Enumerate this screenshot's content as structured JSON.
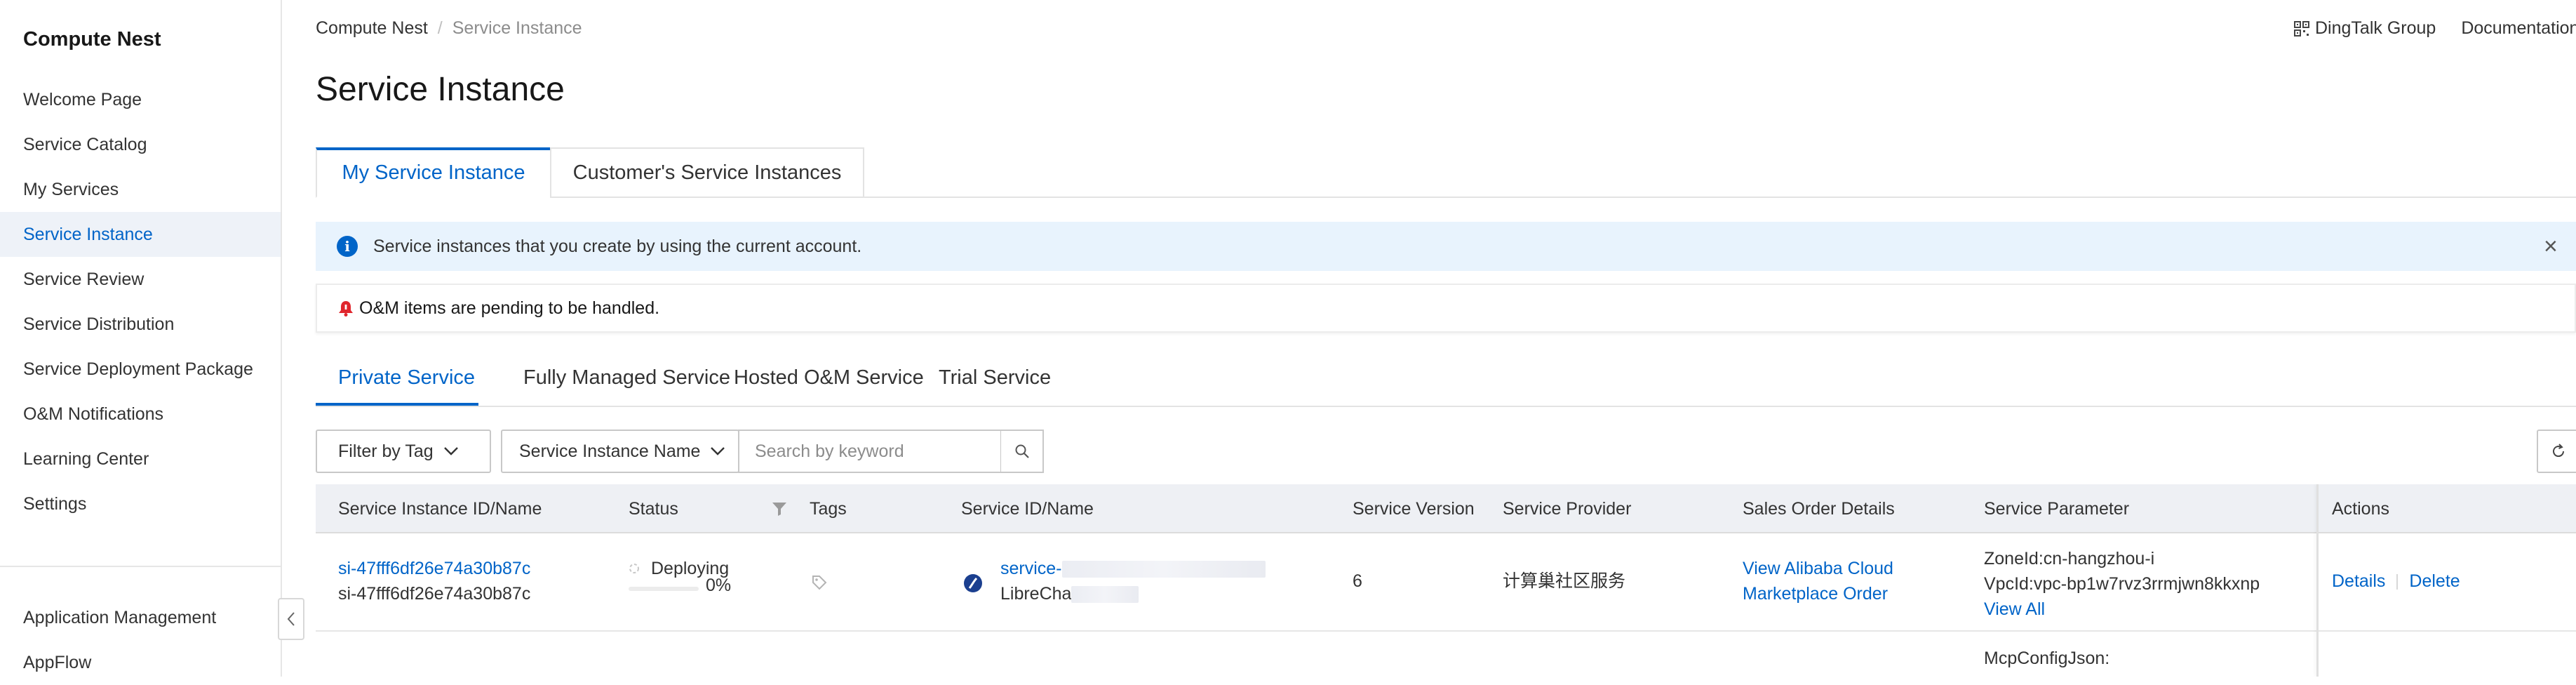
{
  "sidebar": {
    "title": "Compute Nest",
    "items": [
      {
        "label": "Welcome Page"
      },
      {
        "label": "Service Catalog"
      },
      {
        "label": "My Services"
      },
      {
        "label": "Service Instance"
      },
      {
        "label": "Service Review"
      },
      {
        "label": "Service Distribution"
      },
      {
        "label": "Service Deployment Package"
      },
      {
        "label": "O&M Notifications"
      },
      {
        "label": "Learning Center"
      },
      {
        "label": "Settings"
      }
    ],
    "active_item": "Service Instance",
    "bottom_items": [
      {
        "label": "Application Management"
      },
      {
        "label": "AppFlow"
      }
    ]
  },
  "header": {
    "breadcrumb": [
      "Compute Nest",
      "Service Instance"
    ],
    "dingtalk_label": "DingTalk Group",
    "documentation_label": "Documentation"
  },
  "page": {
    "title": "Service Instance",
    "tabs": [
      {
        "label": "My Service Instance",
        "active": true
      },
      {
        "label": "Customer's Service Instances",
        "active": false
      }
    ],
    "info_message": "Service instances that you create by using the current account.",
    "warning_message": "O&M items are pending to be handled.",
    "sub_tabs": [
      {
        "label": "Private Service",
        "active": true
      },
      {
        "label": "Fully Managed Service",
        "active": false
      },
      {
        "label": "Hosted O&M Service",
        "active": false
      },
      {
        "label": "Trial Service",
        "active": false
      }
    ]
  },
  "filters": {
    "tag_filter_label": "Filter by Tag",
    "field_select_value": "Service Instance Name",
    "search_placeholder": "Search by keyword"
  },
  "table": {
    "columns": [
      "Service Instance ID/Name",
      "Status",
      "Tags",
      "Service ID/Name",
      "Service Version",
      "Service Provider",
      "Sales Order Details",
      "Service Parameter",
      "Actions"
    ],
    "rows": [
      {
        "instance_id": "si-47fff6df26e74a30b87c",
        "instance_name": "si-47fff6df26e74a30b87c",
        "status": "Deploying",
        "progress_text": "0%",
        "progress": 0,
        "service_id_prefix": "service-",
        "service_name_prefix": "LibreCha",
        "service_version": "6",
        "service_provider": "计算巢社区服务",
        "sales_order_line1": "View Alibaba Cloud",
        "sales_order_line2": "Marketplace Order",
        "param_zone": "ZoneId:cn-hangzhou-i",
        "param_vpc": "VpcId:vpc-bp1w7rvz3rrmjwn8kkxnp",
        "view_all_label": "View All",
        "details_label": "Details",
        "delete_label": "Delete"
      },
      {
        "param_mcp": "McpConfigJson:"
      }
    ]
  },
  "colors": {
    "accent": "#0064c8",
    "info_bg": "#e8f3fd",
    "warning_bell": "#e0262d",
    "sidebar_active_bg": "#eef2f8",
    "table_header_bg": "#eef0f4"
  }
}
